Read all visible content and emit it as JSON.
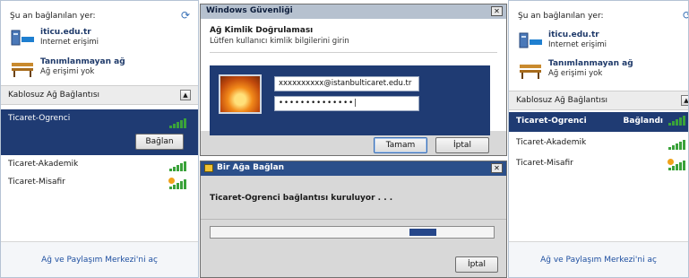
{
  "left_panel": {
    "header": "Şu an bağlanılan yer:",
    "connections": [
      {
        "name": "iticu.edu.tr",
        "status": "Internet erişimi"
      },
      {
        "name": "Tanımlanmayan ağ",
        "status": "Ağ erişimi yok"
      }
    ],
    "wireless_header": "Kablosuz Ağ Bağlantısı",
    "networks": [
      "Ticaret-Ogrenci",
      "Ticaret-Akademik",
      "Ticaret-Misafir"
    ],
    "connect_button": "Bağlan",
    "footer": "Ağ ve Paylaşım Merkezi'ni aç"
  },
  "security_dialog": {
    "title": "Windows Güvenliği",
    "heading": "Ağ Kimlik Doğrulaması",
    "subtitle": "Lütfen kullanıcı kimlik bilgilerini girin",
    "username": "xxxxxxxxxx@istanbulticaret.edu.tr",
    "password_mask": "••••••••••••••|",
    "ok": "Tamam",
    "cancel": "İptal"
  },
  "connect_dialog": {
    "title": "Bir Ağa Bağlan",
    "message": "Ticaret-Ogrenci bağlantısı kuruluyor . . .",
    "cancel": "İptal"
  },
  "right_panel": {
    "header": "Şu an bağlanılan yer:",
    "connections": [
      {
        "name": "iticu.edu.tr",
        "status": "Internet erişimi"
      },
      {
        "name": "Tanımlanmayan ağ",
        "status": "Ağ erişimi yok"
      }
    ],
    "wireless_header": "Kablosuz Ağ Bağlantısı",
    "networks": [
      "Ticaret-Ogrenci",
      "Ticaret-Akademik",
      "Ticaret-Misafir"
    ],
    "connected_label": "Bağlandı",
    "footer": "Ağ ve Paylaşım Merkezi'ni aç"
  },
  "colors": {
    "selection": "#1f3b73",
    "link": "#1e4fa0",
    "signal": "#3aa23a"
  }
}
